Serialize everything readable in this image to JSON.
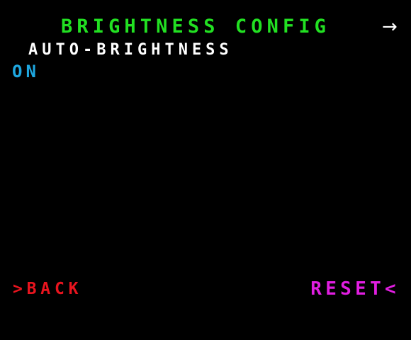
{
  "header": {
    "title": "BRIGHTNESS CONFIG",
    "next_arrow": "→"
  },
  "setting": {
    "label": "AUTO-BRIGHTNESS",
    "value": "ON"
  },
  "footer": {
    "back_label": ">BACK",
    "reset_label": "RESET<"
  },
  "colors": {
    "background": "#000000",
    "title": "#22e022",
    "label": "#ffffff",
    "value": "#1ea7e0",
    "back": "#e8141e",
    "reset": "#e11ee1"
  },
  "icons": {
    "next": "right-arrow-icon"
  }
}
